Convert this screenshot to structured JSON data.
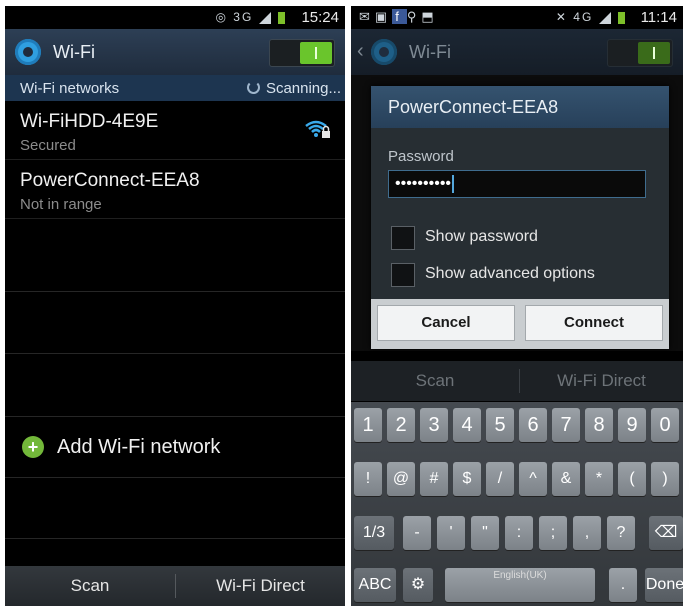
{
  "left": {
    "status": {
      "time": "15:24",
      "network_type": "3G"
    },
    "action_bar": {
      "title": "Wi-Fi",
      "toggle_state": "on"
    },
    "subheader": {
      "label": "Wi-Fi networks",
      "scanning": "Scanning..."
    },
    "networks": [
      {
        "name": "Wi-FiHDD-4E9E",
        "status": "Secured",
        "icon": "wifi-secured-icon"
      },
      {
        "name": "PowerConnect-EEA8",
        "status": "Not in range"
      }
    ],
    "add_network": {
      "label": "Add Wi-Fi network",
      "icon": "plus-icon"
    },
    "bottom_bar": {
      "scan": "Scan",
      "wifi_direct": "Wi-Fi Direct"
    }
  },
  "right": {
    "status": {
      "time": "11:14",
      "network_type": "4G"
    },
    "action_bar": {
      "title": "Wi-Fi"
    },
    "dialog": {
      "title": "PowerConnect-EEA8",
      "password_label": "Password",
      "password_value": "••••••••••",
      "show_password": "Show password",
      "show_advanced": "Show advanced options",
      "cancel": "Cancel",
      "connect": "Connect"
    },
    "bottom_bar": {
      "scan": "Scan",
      "wifi_direct": "Wi-Fi Direct"
    },
    "keyboard": {
      "row1": [
        "1",
        "2",
        "3",
        "4",
        "5",
        "6",
        "7",
        "8",
        "9",
        "0"
      ],
      "row2": [
        "!",
        "@",
        "#",
        "$",
        "/",
        "^",
        "&",
        "*",
        "(",
        ")"
      ],
      "row3": [
        "1/3",
        "-",
        "'",
        "\"",
        ":",
        ";",
        ",",
        "?"
      ],
      "abc": "ABC",
      "language": "English(UK)",
      "period": ".",
      "done": "Done"
    }
  },
  "colors": {
    "accent": "#2f9fe0",
    "toggle_on": "#6ac52c",
    "action_bar": "#263548"
  }
}
